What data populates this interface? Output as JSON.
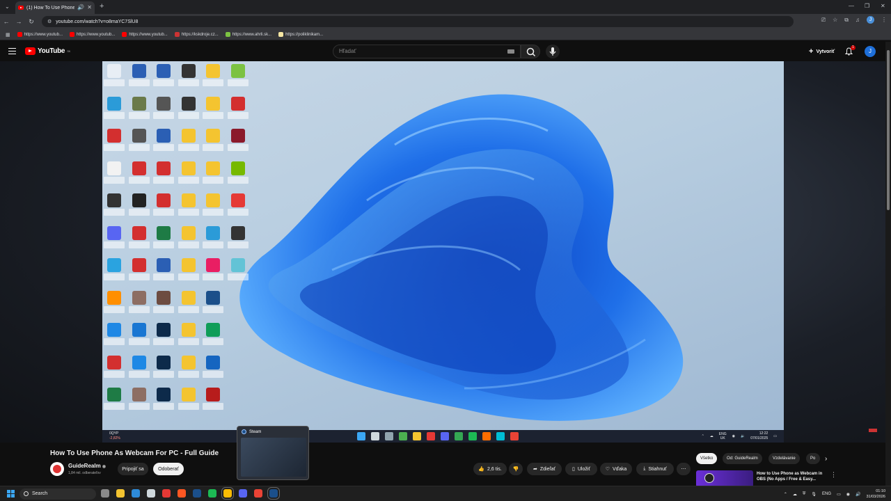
{
  "browser": {
    "tab_title": "(1) How To Use Phone As W...",
    "new_tab_glyph": "+",
    "url": "youtube.com/watch?v=o8maYC7SlU8",
    "bookmarks": [
      {
        "label": "https://www.youtub...",
        "icon": "youtube-favicon",
        "color": "#ff0000"
      },
      {
        "label": "https://www.youtub...",
        "icon": "youtube-favicon",
        "color": "#ff0000"
      },
      {
        "label": "https://www.youtub...",
        "icon": "youtube-favicon",
        "color": "#ff0000"
      },
      {
        "label": "https://kskdroje.cz...",
        "icon": "site-favicon",
        "color": "#cc3333"
      },
      {
        "label": "https://www.ahrli.sk...",
        "icon": "site-favicon",
        "color": "#7cc242"
      },
      {
        "label": "https://poliklinikam...",
        "icon": "site-favicon",
        "color": "#f5e6a3"
      }
    ]
  },
  "youtube": {
    "logo_text": "YouTube",
    "logo_region": "SK",
    "search_placeholder": "Hľadať",
    "create_label": "Vytvoriť",
    "notif_count": "1",
    "avatar_letter": "J"
  },
  "video_overlay": {
    "ticker_symbol": "0QYP",
    "ticker_change": "-2,82%",
    "lang_top": "ENG",
    "lang_bottom": "UK",
    "time": "12:22",
    "date": "07/01/2025",
    "steam_popup": "Steam"
  },
  "video": {
    "title": "How To Use Phone As Webcam For PC - Full Guide",
    "channel": "GuideRealm",
    "subscribers": "1,84 mil. odberateľov",
    "join_label": "Pripojiť sa",
    "subscribe_label": "Odoberať",
    "likes": "2,6 tis.",
    "share_label": "Zdieľať",
    "save_label": "Uložiť",
    "thanks_label": "Vďaka",
    "download_label": "Stiahnuť"
  },
  "chips": [
    {
      "label": "Všetko",
      "active": true
    },
    {
      "label": "Od: GuideRealm",
      "active": false
    },
    {
      "label": "Vzdelávanie",
      "active": false
    },
    {
      "label": "Po",
      "active": false
    }
  ],
  "recommendation": {
    "title": "How to Use Phone as Webcam in OBS (No Apps / Free & Easy..."
  },
  "taskbar": {
    "search_label": "Search",
    "lang": "ENG",
    "time": "01:10",
    "date": "31/03/2026"
  }
}
